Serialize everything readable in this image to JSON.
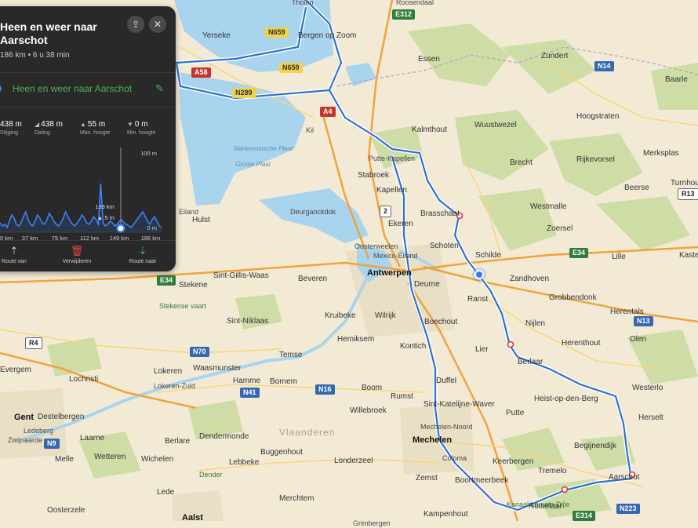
{
  "panel": {
    "title": "Heen en weer naar Aarschot",
    "subtitle": "186 km • 6 u 38 min",
    "route_name": "Heen en weer naar Aarschot",
    "share_icon": "share-icon",
    "close_icon": "close-icon",
    "stats": [
      {
        "value": "438 m",
        "label": "Stijging",
        "icon": "arrow-up-icon"
      },
      {
        "value": "438 m",
        "label": "Daling",
        "icon": "arrow-down-icon"
      },
      {
        "value": "55 m",
        "label": "Max. hoogte",
        "icon": "max-height-icon"
      },
      {
        "value": "0 m",
        "label": "Min. hoogte",
        "icon": "min-height-icon"
      }
    ],
    "elevation": {
      "y_top_label": "100 m",
      "y_bottom_label": "0 m",
      "x_ticks": [
        "0 km",
        "37 km",
        "75 km",
        "112 km",
        "149 km",
        "186 km"
      ],
      "cursor_km_label": "139 km",
      "cursor_height_label": "▲ 5 m",
      "profile_m": [
        12,
        8,
        10,
        6,
        14,
        22,
        18,
        10,
        8,
        12,
        20,
        26,
        16,
        10,
        8,
        14,
        22,
        18,
        12,
        10,
        16,
        24,
        20,
        14,
        10,
        8,
        12,
        18,
        26,
        20,
        14,
        10,
        8,
        12,
        16,
        22,
        18,
        12,
        10,
        14,
        20,
        16,
        10,
        62,
        12,
        8,
        10,
        14,
        12,
        8,
        10,
        14,
        16,
        12,
        10,
        8,
        6,
        10,
        14,
        18,
        22,
        26,
        20,
        14,
        10,
        16,
        20,
        14,
        8,
        6
      ],
      "cursor_km": 139,
      "cursor_value": 5,
      "max_km": 186
    },
    "actions": [
      {
        "label": "Route van",
        "icon": "route-from-icon",
        "color": "#dddddd"
      },
      {
        "label": "Verwijderen",
        "icon": "trash-icon",
        "color": "#e0463c"
      },
      {
        "label": "Route naar",
        "icon": "route-to-icon",
        "color": "#4db352"
      }
    ]
  },
  "map": {
    "colors": {
      "land": "#f3ead6",
      "water": "#a9d4ee",
      "forest": "#c9dca0",
      "route": "#2f6fd0",
      "urban": "#ebe1c9",
      "motorway": "#f1a33a",
      "road": "#f7d77a"
    },
    "route_stops": [
      {
        "name": "Brasschaat"
      },
      {
        "name": "Lier"
      },
      {
        "name": "Aarschot"
      },
      {
        "name": "Rotselaar"
      }
    ],
    "labels": [
      {
        "text": "Tholen",
        "cls": "small"
      },
      {
        "text": "Roosendaal",
        "cls": "small"
      },
      {
        "text": "Yerseke",
        "cls": ""
      },
      {
        "text": "Bergen op Zoom",
        "cls": ""
      },
      {
        "text": "Essen",
        "cls": ""
      },
      {
        "text": "Zundert",
        "cls": ""
      },
      {
        "text": "Baarle",
        "cls": ""
      },
      {
        "text": "Hoogstraten",
        "cls": ""
      },
      {
        "text": "Merksplas",
        "cls": ""
      },
      {
        "text": "Rijkevorsel",
        "cls": ""
      },
      {
        "text": "Kalmthout",
        "cls": ""
      },
      {
        "text": "Wuustwezel",
        "cls": ""
      },
      {
        "text": "Brecht",
        "cls": ""
      },
      {
        "text": "Kil",
        "cls": "small"
      },
      {
        "text": "Putte-Kapellen",
        "cls": "small"
      },
      {
        "text": "Stabroek",
        "cls": ""
      },
      {
        "text": "Kapellen",
        "cls": ""
      },
      {
        "text": "Brasschaat",
        "cls": ""
      },
      {
        "text": "Westmalle",
        "cls": ""
      },
      {
        "text": "Beerse",
        "cls": ""
      },
      {
        "text": "Turnhout",
        "cls": ""
      },
      {
        "text": "Zoersel",
        "cls": ""
      },
      {
        "text": "Hulst",
        "cls": ""
      },
      {
        "text": "Deurganckdok",
        "cls": "small"
      },
      {
        "text": "Ekeren",
        "cls": ""
      },
      {
        "text": "Schoten",
        "cls": ""
      },
      {
        "text": "Schilde",
        "cls": ""
      },
      {
        "text": "Lille",
        "cls": ""
      },
      {
        "text": "Kasterlee",
        "cls": ""
      },
      {
        "text": "Oosterweelen",
        "cls": "small"
      },
      {
        "text": "Mexico-Eiland",
        "cls": "small"
      },
      {
        "text": "Stekene",
        "cls": ""
      },
      {
        "text": "Sint-Gillis-Waas",
        "cls": ""
      },
      {
        "text": "Beveren",
        "cls": ""
      },
      {
        "text": "Antwerpen",
        "cls": "city"
      },
      {
        "text": "Deurne",
        "cls": ""
      },
      {
        "text": "Zandhoven",
        "cls": ""
      },
      {
        "text": "Ranst",
        "cls": ""
      },
      {
        "text": "Grobbendonk",
        "cls": ""
      },
      {
        "text": "Herentals",
        "cls": ""
      },
      {
        "text": "Stekense vaart",
        "cls": "green"
      },
      {
        "text": "Sint-Niklaas",
        "cls": ""
      },
      {
        "text": "Kruibeke",
        "cls": ""
      },
      {
        "text": "Wilrijk",
        "cls": ""
      },
      {
        "text": "Boechout",
        "cls": ""
      },
      {
        "text": "Nijlen",
        "cls": ""
      },
      {
        "text": "Olen",
        "cls": ""
      },
      {
        "text": "Hemiksem",
        "cls": ""
      },
      {
        "text": "Kontich",
        "cls": ""
      },
      {
        "text": "Lier",
        "cls": ""
      },
      {
        "text": "Herenthout",
        "cls": ""
      },
      {
        "text": "Temse",
        "cls": ""
      },
      {
        "text": "Berlaar",
        "cls": ""
      },
      {
        "text": "Evergem",
        "cls": ""
      },
      {
        "text": "Lokeren",
        "cls": ""
      },
      {
        "text": "Waasmunster",
        "cls": ""
      },
      {
        "text": "Lokeren-Zuid",
        "cls": "small"
      },
      {
        "text": "Lochristi",
        "cls": ""
      },
      {
        "text": "Hamme",
        "cls": ""
      },
      {
        "text": "Bornem",
        "cls": ""
      },
      {
        "text": "Boom",
        "cls": ""
      },
      {
        "text": "Duffel",
        "cls": ""
      },
      {
        "text": "Westerlo",
        "cls": ""
      },
      {
        "text": "Heist-op-den-Berg",
        "cls": ""
      },
      {
        "text": "Rumst",
        "cls": ""
      },
      {
        "text": "Sint-Katelijne-Waver",
        "cls": ""
      },
      {
        "text": "Willebroek",
        "cls": ""
      },
      {
        "text": "Putte",
        "cls": ""
      },
      {
        "text": "Herselt",
        "cls": ""
      },
      {
        "text": "Gent",
        "cls": "city"
      },
      {
        "text": "Destelbergen",
        "cls": ""
      },
      {
        "text": "Ledeberg",
        "cls": "small"
      },
      {
        "text": "Dendermonde",
        "cls": ""
      },
      {
        "text": "Vlaanderen",
        "cls": "region"
      },
      {
        "text": "Mechelen-Noord",
        "cls": "small"
      },
      {
        "text": "Mechelen",
        "cls": "city"
      },
      {
        "text": "Laarne",
        "cls": ""
      },
      {
        "text": "Berlare",
        "cls": ""
      },
      {
        "text": "Buggenhout",
        "cls": ""
      },
      {
        "text": "Begijnendijk",
        "cls": ""
      },
      {
        "text": "Zwijnaarde",
        "cls": "small"
      },
      {
        "text": "Melle",
        "cls": ""
      },
      {
        "text": "Wetteren",
        "cls": ""
      },
      {
        "text": "Wichelen",
        "cls": ""
      },
      {
        "text": "Lebbeke",
        "cls": ""
      },
      {
        "text": "Londerzeel",
        "cls": ""
      },
      {
        "text": "Coloma",
        "cls": "small"
      },
      {
        "text": "Keerbergen",
        "cls": ""
      },
      {
        "text": "Tremelo",
        "cls": ""
      },
      {
        "text": "Aarschot",
        "cls": ""
      },
      {
        "text": "Dender",
        "cls": "green"
      },
      {
        "text": "Zemst",
        "cls": ""
      },
      {
        "text": "Boortmeerbeek",
        "cls": ""
      },
      {
        "text": "Oosterzele",
        "cls": ""
      },
      {
        "text": "Lede",
        "cls": ""
      },
      {
        "text": "Merchtem",
        "cls": ""
      },
      {
        "text": "Kanaal Leuven-Dijle",
        "cls": "green"
      },
      {
        "text": "Kampenhout",
        "cls": ""
      },
      {
        "text": "Rotselaar",
        "cls": ""
      },
      {
        "text": "Aalst",
        "cls": "city"
      },
      {
        "text": "Grimbergen",
        "cls": "small"
      },
      {
        "text": "Marlemontsche Plaat",
        "cls": "water"
      },
      {
        "text": "Groote Plaat",
        "cls": "water"
      },
      {
        "text": "Eiland",
        "cls": "small"
      }
    ],
    "shields": [
      {
        "text": "E312",
        "cls": "g"
      },
      {
        "text": "N659",
        "cls": "y"
      },
      {
        "text": "N659",
        "cls": "y"
      },
      {
        "text": "A58",
        "cls": "r"
      },
      {
        "text": "N289",
        "cls": "y"
      },
      {
        "text": "A4",
        "cls": "r"
      },
      {
        "text": "N14",
        "cls": "b"
      },
      {
        "text": "R13",
        "cls": "w"
      },
      {
        "text": "2",
        "cls": "w"
      },
      {
        "text": "E34",
        "cls": "g"
      },
      {
        "text": "E34",
        "cls": "g"
      },
      {
        "text": "N13",
        "cls": "b"
      },
      {
        "text": "R4",
        "cls": "w"
      },
      {
        "text": "N70",
        "cls": "b"
      },
      {
        "text": "N41",
        "cls": "b"
      },
      {
        "text": "N16",
        "cls": "b"
      },
      {
        "text": "N9",
        "cls": "b"
      },
      {
        "text": "E314",
        "cls": "g"
      },
      {
        "text": "N223",
        "cls": "b"
      }
    ]
  }
}
